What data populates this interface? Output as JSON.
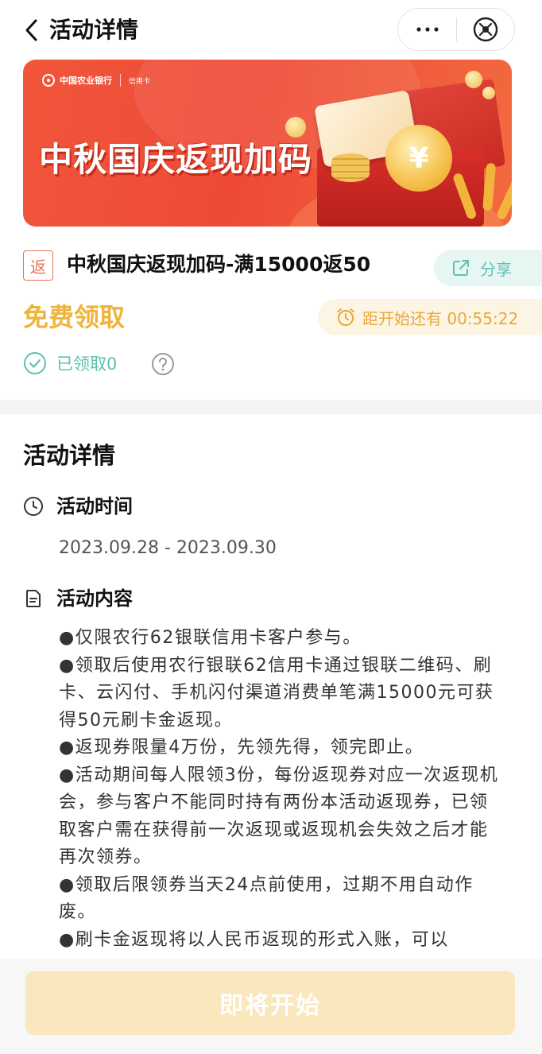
{
  "header": {
    "title": "活动详情",
    "more_label": "···"
  },
  "banner": {
    "bank_name": "中国农业银行",
    "card_label": "信用卡",
    "title": "中秋国庆返现加码",
    "coin_symbol": "¥"
  },
  "activity": {
    "tag": "返",
    "name": "中秋国庆返现加码-满15000返50",
    "share_label": "分享",
    "price_label": "免费领取",
    "countdown": "距开始还有 00:55:22",
    "claimed": "已领取0"
  },
  "details": {
    "section_title": "活动详情",
    "time_label": "活动时间",
    "time_value": "2023.09.28 - 2023.09.30",
    "content_label": "活动内容",
    "content_lines": [
      "●仅限农行62银联信用卡客户参与。",
      "●领取后使用农行银联62信用卡通过银联二维码、刷卡、云闪付、手机闪付渠道消费单笔满15000元可获得50元刷卡金返现。",
      "●返现券限量4万份，先领先得，领完即止。",
      "●活动期间每人限领3份，每份返现券对应一次返现机会，参与客户不能同时持有两份本活动返现券，已领取客户需在获得前一次返现或返现机会失效之后才能再次领券。",
      "●领取后限领券当天24点前使用，过期不用自动作废。",
      "●刷卡金返现将以人民币返现的形式入账，可以"
    ]
  },
  "footer": {
    "button_label": "即将开始"
  },
  "colors": {
    "accent_green": "#5fc1b2",
    "accent_gold": "#f0b43c",
    "banner_red": "#ee4a36",
    "button_disabled": "#fbe7bd"
  },
  "icons": [
    "back-icon",
    "more-icon",
    "close-icon",
    "share-icon",
    "alarm-clock-icon",
    "check-circle-icon",
    "help-icon",
    "clock-icon",
    "document-icon"
  ]
}
